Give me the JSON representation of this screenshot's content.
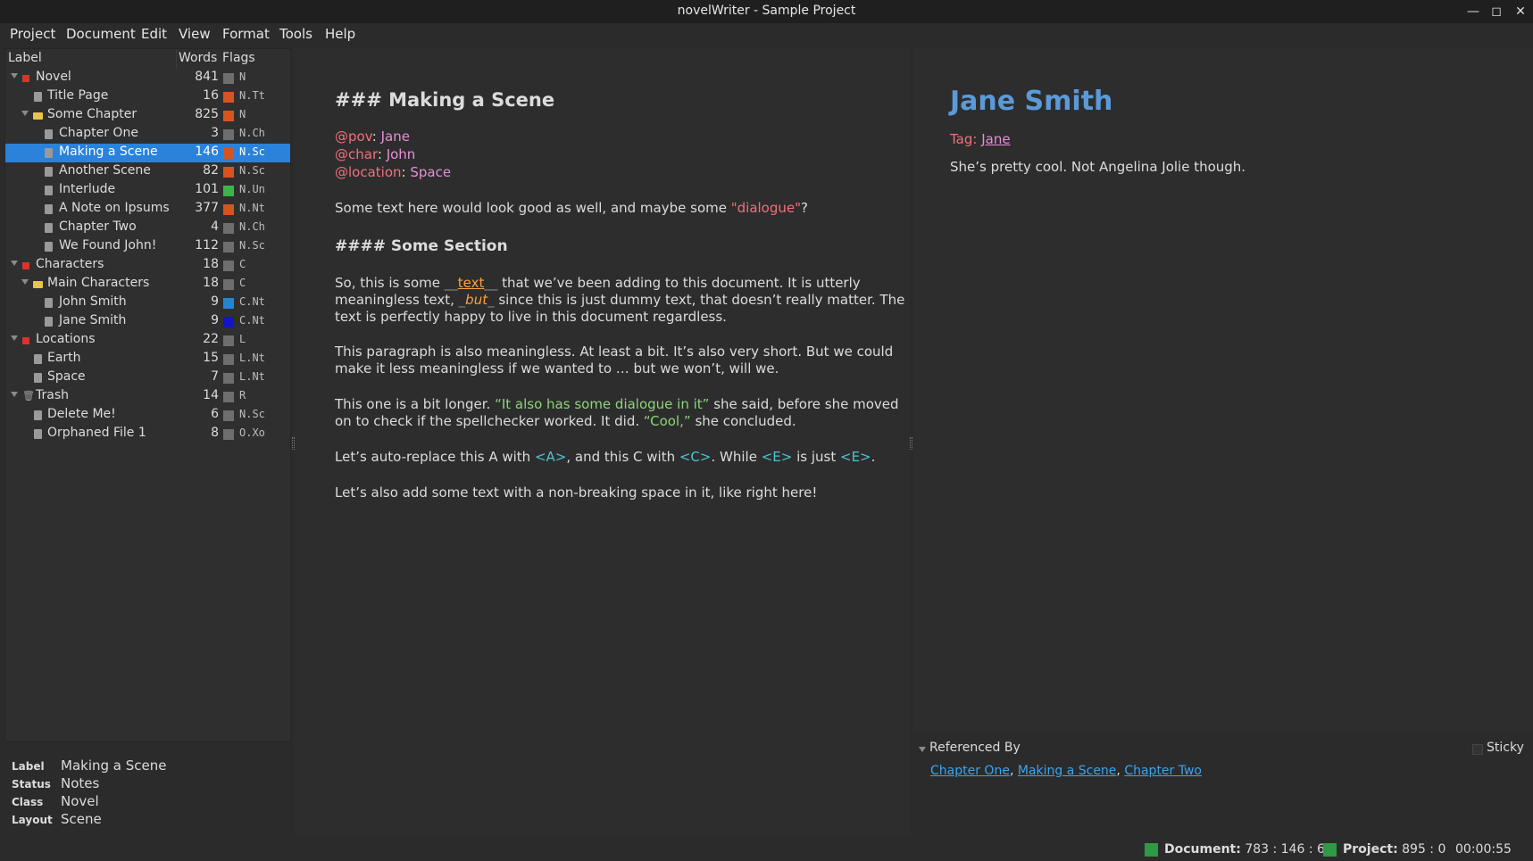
{
  "window": {
    "title": "novelWriter - Sample Project"
  },
  "menu": [
    "Project",
    "Document",
    "Edit",
    "View",
    "Format",
    "Tools",
    "Help"
  ],
  "tree": {
    "headers": {
      "label": "Label",
      "words": "Words",
      "flags": "Flags"
    },
    "items": [
      {
        "label": "Novel",
        "words": "841",
        "flags": "N",
        "color": "#6e6e6e",
        "icon": "root-icon",
        "depth": 0
      },
      {
        "label": "Title Page",
        "words": "16",
        "flags": "N.Tt",
        "color": "#d9531e",
        "icon": "document-icon",
        "depth": 1
      },
      {
        "label": "Some Chapter",
        "words": "825",
        "flags": "N",
        "color": "#d9531e",
        "icon": "folder-icon",
        "depth": 1
      },
      {
        "label": "Chapter One",
        "words": "3",
        "flags": "N.Ch",
        "color": "#6e6e6e",
        "icon": "document-icon",
        "depth": 2
      },
      {
        "label": "Making a Scene",
        "words": "146",
        "flags": "N.Sc",
        "color": "#d9531e",
        "icon": "document-icon",
        "depth": 2,
        "selected": true
      },
      {
        "label": "Another Scene",
        "words": "82",
        "flags": "N.Sc",
        "color": "#d9531e",
        "icon": "document-icon",
        "depth": 2
      },
      {
        "label": "Interlude",
        "words": "101",
        "flags": "N.Un",
        "color": "#3ab54a",
        "icon": "document-icon",
        "depth": 2
      },
      {
        "label": "A Note on Ipsums",
        "words": "377",
        "flags": "N.Nt",
        "color": "#d9531e",
        "icon": "document-icon",
        "depth": 2
      },
      {
        "label": "Chapter Two",
        "words": "4",
        "flags": "N.Ch",
        "color": "#6e6e6e",
        "icon": "document-icon",
        "depth": 2
      },
      {
        "label": "We Found John!",
        "words": "112",
        "flags": "N.Sc",
        "color": "#6e6e6e",
        "icon": "document-icon",
        "depth": 2
      },
      {
        "label": "Characters",
        "words": "18",
        "flags": "C",
        "color": "#6e6e6e",
        "icon": "root-icon",
        "depth": 0
      },
      {
        "label": "Main Characters",
        "words": "18",
        "flags": "C",
        "color": "#6e6e6e",
        "icon": "folder-icon",
        "depth": 1
      },
      {
        "label": "John Smith",
        "words": "9",
        "flags": "C.Nt",
        "color": "#1e88d6",
        "icon": "document-icon",
        "depth": 2
      },
      {
        "label": "Jane Smith",
        "words": "9",
        "flags": "C.Nt",
        "color": "#1515c8",
        "icon": "document-icon",
        "depth": 2
      },
      {
        "label": "Locations",
        "words": "22",
        "flags": "L",
        "color": "#6e6e6e",
        "icon": "root-icon",
        "depth": 0
      },
      {
        "label": "Earth",
        "words": "15",
        "flags": "L.Nt",
        "color": "#6e6e6e",
        "icon": "document-icon",
        "depth": 1
      },
      {
        "label": "Space",
        "words": "7",
        "flags": "L.Nt",
        "color": "#6e6e6e",
        "icon": "document-icon",
        "depth": 1
      },
      {
        "label": "Trash",
        "words": "14",
        "flags": "R",
        "color": "#6e6e6e",
        "icon": "trash-icon",
        "depth": 0
      },
      {
        "label": "Delete Me!",
        "words": "6",
        "flags": "N.Sc",
        "color": "#6e6e6e",
        "icon": "document-icon",
        "depth": 1
      },
      {
        "label": "Orphaned File 1",
        "words": "8",
        "flags": "O.Xo",
        "color": "#6e6e6e",
        "icon": "document-icon",
        "depth": 1
      }
    ]
  },
  "details": {
    "label_key": "Label",
    "label_val": "Making a Scene",
    "status_key": "Status",
    "status_val": "Notes",
    "class_key": "Class",
    "class_val": "Novel",
    "layout_key": "Layout",
    "layout_val": "Scene"
  },
  "editor": {
    "heading": "### Making a Scene",
    "pov_key": "@pov",
    "pov_val": "Jane",
    "char_key": "@char",
    "char_val": "John",
    "location_key": "@location",
    "location_val": "Space",
    "p1_a": "Some text here would look good as well, and maybe some ",
    "p1_dialogue": "\"dialogue\"",
    "p1_b": "?",
    "subheading": "#### Some Section",
    "p2_l1_a": "So, this is some ",
    "p2_bold_open": "__",
    "p2_bold": "text",
    "p2_bold_close": "__",
    "p2_l1_b": " that we’ve been adding to this document. It is utterly",
    "p2_l2_a": "meaningless text, ",
    "p2_em_open": "_",
    "p2_em": "but",
    "p2_em_close": "_",
    "p2_l2_b": " since this is just dummy text, that doesn’t really matter. The",
    "p2_l3": "text is perfectly happy to live in this document regardless.",
    "p3_l1": "This paragraph is also meaningless. At least a bit. It’s also very short. But we could",
    "p3_l2": "make it less meaningless if we wanted to … but we won’t, will we.",
    "p4_l1_a": "This one is a bit longer. ",
    "p4_q1": "“It also has some dialogue in it”",
    "p4_l1_b": " she said, before she moved",
    "p4_l2_a": "on to check if the spellchecker worked. It did. ",
    "p4_q2": "“Cool,”",
    "p4_l2_b": " she concluded.",
    "p5_a": "Let’s auto-replace this A with ",
    "p5_r1": "<A>",
    "p5_b": ", and this C with ",
    "p5_r2": "<C>",
    "p5_c": ".  While ",
    "p5_r3": "<E>",
    "p5_d": " is just ",
    "p5_r4": "<E>",
    "p5_e": ".",
    "p6": "Let’s also add some text with a non-breaking space in it, like right here!"
  },
  "viewer": {
    "title": "Jane Smith",
    "tag_key": "Tag:",
    "tag_val": "Jane",
    "body": "She’s pretty cool. Not Angelina Jolie though."
  },
  "refs": {
    "header": "Referenced By",
    "sticky": "Sticky",
    "links": [
      "Chapter One",
      "Making a Scene",
      "Chapter Two"
    ],
    "sep": ", "
  },
  "status": {
    "doc_label": "Document:",
    "doc_value": "783 : 146 : 6",
    "proj_label": "Project:",
    "proj_value": "895 : 0",
    "timer": "00:00:55",
    "indicator_color": "#2e9a45"
  }
}
